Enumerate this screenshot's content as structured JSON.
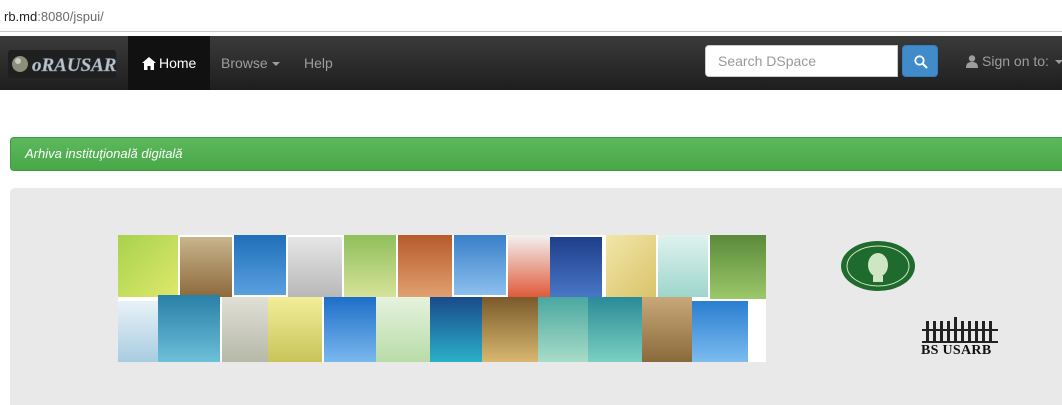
{
  "browser": {
    "url_host": "rb.md",
    "url_rest": ":8080/jspui/"
  },
  "navbar": {
    "brand_label": "oRAUSARB",
    "home_label": "Home",
    "browse_label": "Browse",
    "help_label": "Help",
    "search_placeholder": "Search DSpace",
    "signon_label": "Sign on to:"
  },
  "banner": {
    "text": "Arhiva instituţională digitală"
  },
  "jumbotron": {
    "bs_logo_text": "BS USARB"
  },
  "colors": {
    "navbar": "#222222",
    "banner_green": "#5cb85c",
    "search_button": "#428bca",
    "jumbotron_bg": "#e9e9e9"
  },
  "icons": [
    "home-icon",
    "caret-down-icon",
    "search-icon",
    "user-icon"
  ]
}
